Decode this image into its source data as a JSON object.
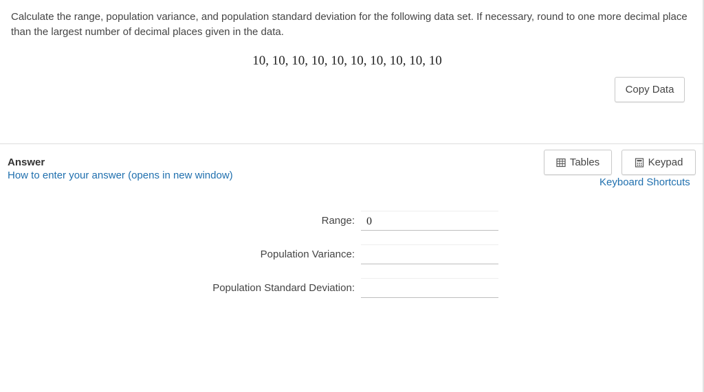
{
  "question": {
    "prompt": "Calculate the range, population variance, and population standard deviation for the following data set. If necessary, round to one more decimal place than the largest number of decimal places given in the data.",
    "data_set": "10, 10, 10, 10, 10, 10, 10, 10, 10, 10",
    "copy_label": "Copy Data"
  },
  "answer": {
    "title": "Answer",
    "how_to_link": "How to enter your answer (opens in new window)",
    "tables_label": "Tables",
    "keypad_label": "Keypad",
    "shortcuts_link": "Keyboard Shortcuts",
    "tables_icon": "grid-icon",
    "keypad_icon": "calculator-icon",
    "fields": {
      "range_label": "Range:",
      "range_value": "0",
      "variance_label": "Population Variance:",
      "variance_value": "",
      "stddev_label": "Population Standard Deviation:",
      "stddev_value": ""
    }
  },
  "colors": {
    "link": "#1f6fae",
    "divider": "#dddddd",
    "button_border": "#c9c9c9"
  }
}
